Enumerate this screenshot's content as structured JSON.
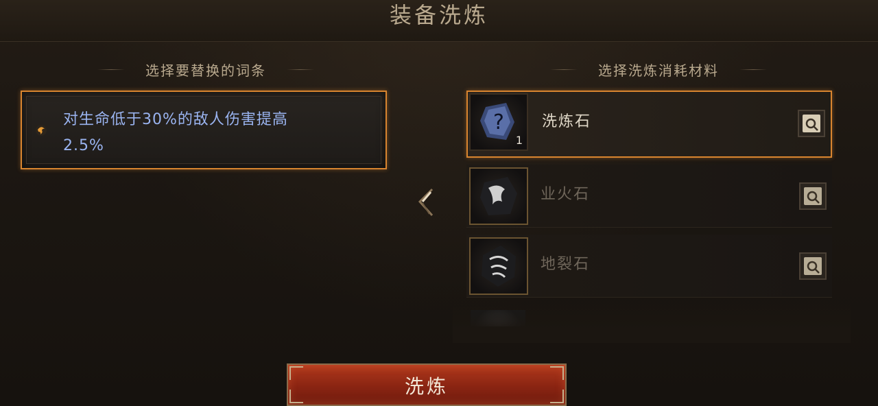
{
  "page": {
    "title": "装备洗炼"
  },
  "left_panel": {
    "heading": "选择要替换的词条",
    "affix": {
      "text_line1": "对生命低于30%的敌人伤害提高",
      "text_line2": "2.5%",
      "color": "#9ab4f0"
    }
  },
  "right_panel": {
    "heading": "选择洗炼消耗材料",
    "materials": [
      {
        "name": "洗炼石",
        "count": "1",
        "icon": "question-stone-icon",
        "selected": true
      },
      {
        "name": "业火石",
        "count": "",
        "icon": "fire-rune-stone-icon",
        "selected": false
      },
      {
        "name": "地裂石",
        "count": "",
        "icon": "earth-rune-stone-icon",
        "selected": false
      }
    ]
  },
  "actions": {
    "refine_label": "洗炼"
  },
  "colors": {
    "accent": "#d9852f",
    "button": "#8a2412",
    "text_gold": "#b9a98e"
  }
}
